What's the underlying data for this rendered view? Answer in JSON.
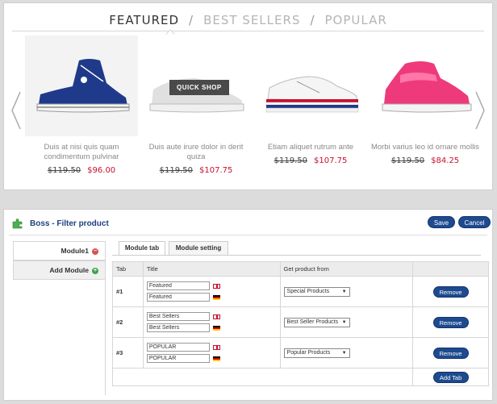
{
  "storefront": {
    "tabs": [
      "FEATURED",
      "BEST SELLERS",
      "POPULAR"
    ],
    "separator": "/",
    "quick_shop_label": "QUICK SHOP",
    "products": [
      {
        "name_line1": "Duis at nisi quis quam",
        "name_line2": "condimentum pulvinar",
        "old_price": "$119.50",
        "new_price": "$96.00",
        "shoe_color": "#1f3a8a"
      },
      {
        "name_line1": "Duis aute irure dolor in derit",
        "name_line2": "quiza",
        "old_price": "$119.50",
        "new_price": "$107.75",
        "shoe_color": "#c9c9c9"
      },
      {
        "name_line1": "Etiam aliquet rutrum ante",
        "name_line2": "",
        "old_price": "$119.50",
        "new_price": "$107.75",
        "shoe_color": "#f2f2f2"
      },
      {
        "name_line1": "Morbi varius leo id ornare mollis",
        "name_line2": "",
        "old_price": "$119.50",
        "new_price": "$84.25",
        "shoe_color": "#ee3a7a"
      }
    ]
  },
  "admin": {
    "title": "Boss - Filter product",
    "save_label": "Save",
    "cancel_label": "Cancel",
    "sidebar": {
      "module_label": "Module1",
      "add_module_label": "Add Module"
    },
    "subtabs": [
      "Module tab",
      "Module setting"
    ],
    "table": {
      "headers": [
        "Tab",
        "Title",
        "Get product from",
        ""
      ],
      "rows": [
        {
          "tab": "#1",
          "title_en": "Featured",
          "title_de": "Featured",
          "source": "Special Products"
        },
        {
          "tab": "#2",
          "title_en": "Best Sellers",
          "title_de": "Best Sellers",
          "source": "Best Seller Products"
        },
        {
          "tab": "#3",
          "title_en": "POPULAR",
          "title_de": "POPULAR",
          "source": "Popular Products"
        }
      ],
      "remove_label": "Remove",
      "add_tab_label": "Add Tab"
    }
  },
  "colors": {
    "accent_blue": "#1e4a8f",
    "price_red": "#c8102e"
  }
}
